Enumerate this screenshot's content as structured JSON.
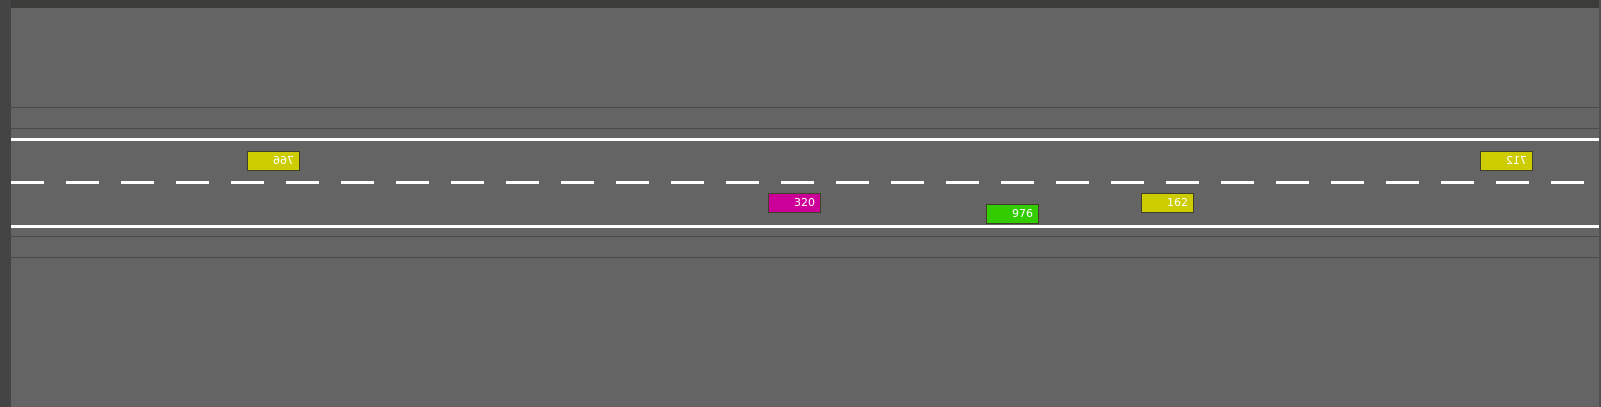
{
  "colors": {
    "background": "#646464",
    "lane_marking": "#ffffff",
    "yellow_vehicle": "#cccc00",
    "magenta_vehicle": "#cc0099",
    "green_vehicle": "#33cc00"
  },
  "vehicles": [
    {
      "id": "766",
      "label": "766",
      "color": "#cccc00",
      "direction": "westbound",
      "lane": "upper"
    },
    {
      "id": "712",
      "label": "712",
      "color": "#cccc00",
      "direction": "westbound",
      "lane": "upper"
    },
    {
      "id": "320",
      "label": "320",
      "color": "#cc0099",
      "direction": "eastbound",
      "lane": "lower"
    },
    {
      "id": "976",
      "label": "976",
      "color": "#33cc00",
      "direction": "eastbound",
      "lane": "lower"
    },
    {
      "id": "162",
      "label": "162",
      "color": "#cccc00",
      "direction": "eastbound",
      "lane": "lower"
    }
  ]
}
